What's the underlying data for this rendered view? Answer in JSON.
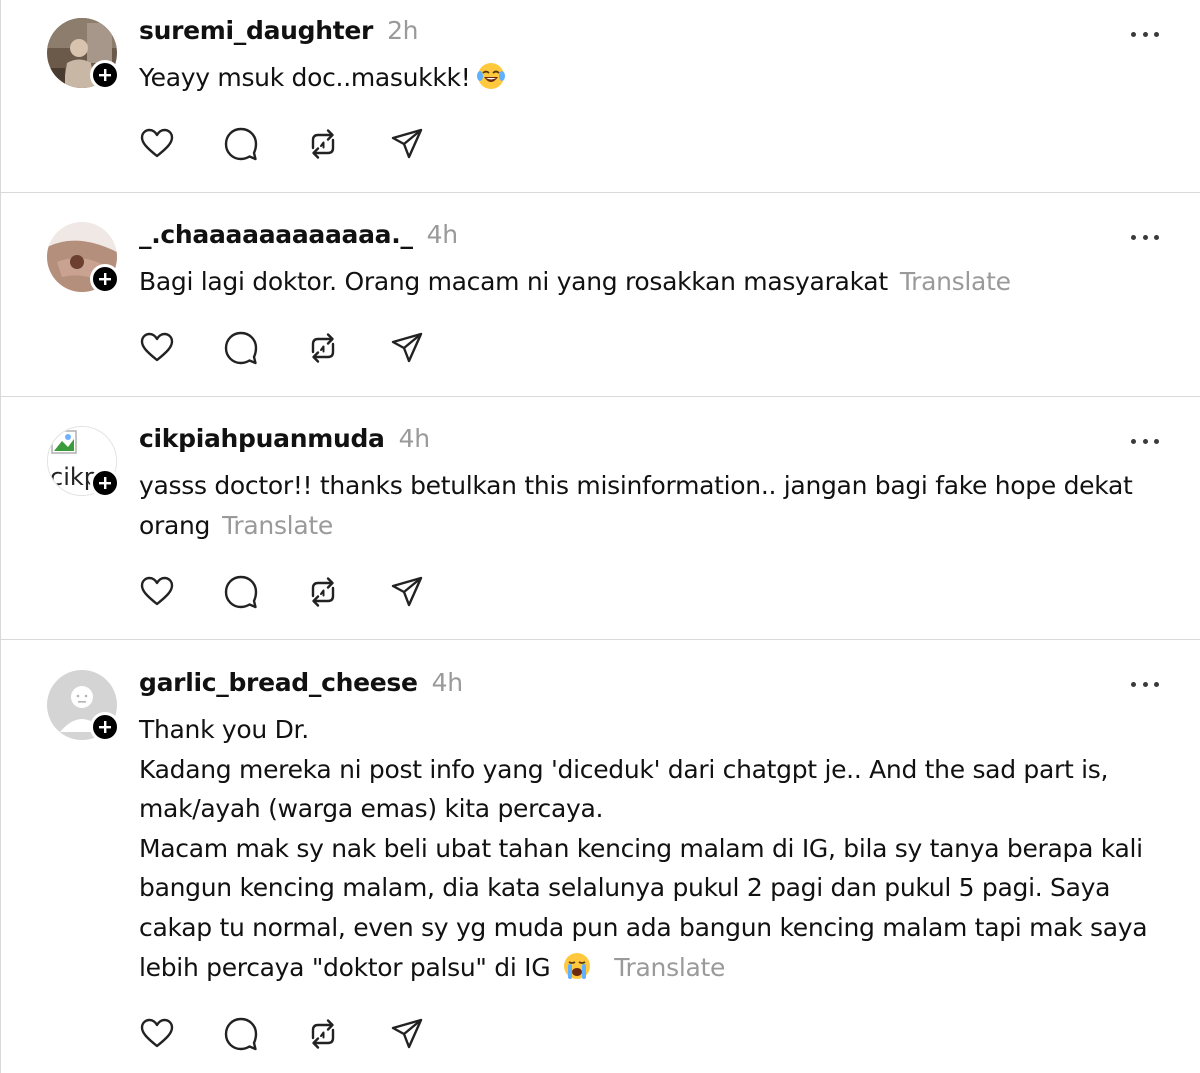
{
  "posts": [
    {
      "username": "suremi_daughter",
      "time": "2h",
      "lines": [
        "Yeayy msuk doc..masukkk!"
      ],
      "emoji": "laughing-tears",
      "translate": ""
    },
    {
      "username": "_.chaaaaaaaaaaaa._",
      "time": "4h",
      "lines": [
        "Bagi lagi doktor. Orang macam ni yang rosakkan masyarakat"
      ],
      "translate": "Translate"
    },
    {
      "username": "cikpiahpuanmuda",
      "time": "4h",
      "avatar_alt": "cikp",
      "lines": [
        "yasss doctor!! thanks betulkan this misinformation.. jangan bagi fake hope dekat",
        "orang"
      ],
      "translate": "Translate"
    },
    {
      "username": "garlic_bread_cheese",
      "time": "4h",
      "lines": [
        "Thank you Dr.",
        "Kadang mereka ni post info yang 'diceduk' dari chatgpt je.. And the sad part is,",
        "mak/ayah (warga emas) kita percaya.",
        "Macam mak sy nak beli ubat tahan kencing malam di IG, bila sy tanya berapa kali",
        "bangun kencing malam, dia kata selalunya pukul 2 pagi dan pukul 5 pagi. Saya",
        "cakap tu normal, even sy yg muda pun ada bangun kencing malam tapi mak saya",
        "lebih percaya \"doktor palsu\" di IG"
      ],
      "emoji": "loudly-crying",
      "translate": "Translate"
    }
  ],
  "colors": {
    "text": "#111111",
    "muted": "#9a9a9a",
    "divider": "#d9d9d9",
    "badge": "#000000"
  },
  "icons": [
    "heart-icon",
    "comment-icon",
    "repost-icon",
    "share-icon",
    "more-icon",
    "follow-plus-icon"
  ]
}
